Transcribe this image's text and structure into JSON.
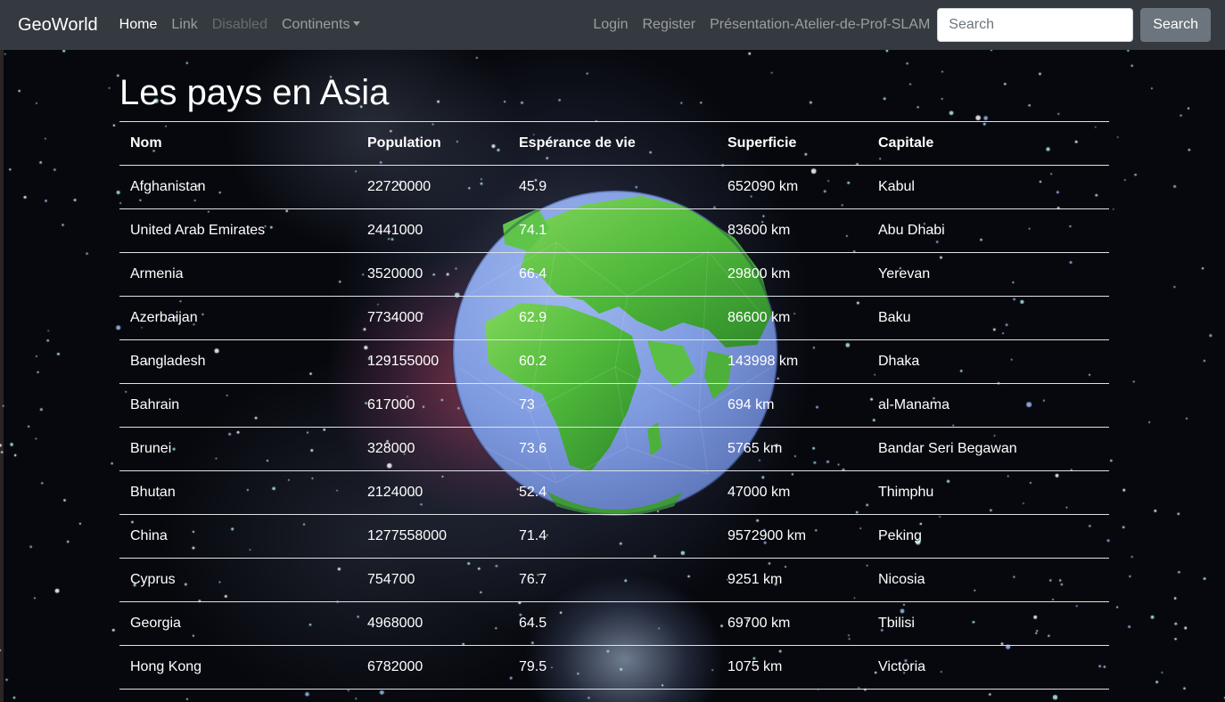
{
  "navbar": {
    "brand": "GeoWorld",
    "links": [
      "Home",
      "Link",
      "Disabled",
      "Continents"
    ],
    "right_links": [
      "Login",
      "Register",
      "Présentation-Atelier-de-Prof-SLAM"
    ],
    "search_placeholder": "Search",
    "search_button": "Search"
  },
  "page": {
    "title": "Les pays en Asia"
  },
  "table": {
    "headers": [
      "Nom",
      "Population",
      "Espérance de vie",
      "Superficie",
      "Capitale"
    ],
    "rows": [
      [
        "Afghanistan",
        "22720000",
        "45.9",
        "652090 km",
        "Kabul"
      ],
      [
        "United Arab Emirates",
        "2441000",
        "74.1",
        "83600 km",
        "Abu Dhabi"
      ],
      [
        "Armenia",
        "3520000",
        "66.4",
        "29800 km",
        "Yerevan"
      ],
      [
        "Azerbaijan",
        "7734000",
        "62.9",
        "86600 km",
        "Baku"
      ],
      [
        "Bangladesh",
        "129155000",
        "60.2",
        "143998 km",
        "Dhaka"
      ],
      [
        "Bahrain",
        "617000",
        "73",
        "694 km",
        "al-Manama"
      ],
      [
        "Brunei",
        "328000",
        "73.6",
        "5765 km",
        "Bandar Seri Begawan"
      ],
      [
        "Bhutan",
        "2124000",
        "52.4",
        "47000 km",
        "Thimphu"
      ],
      [
        "China",
        "1277558000",
        "71.4",
        "9572900 km",
        "Peking"
      ],
      [
        "Cyprus",
        "754700",
        "76.7",
        "9251 km",
        "Nicosia"
      ],
      [
        "Georgia",
        "4968000",
        "64.5",
        "69700 km",
        "Tbilisi"
      ],
      [
        "Hong Kong",
        "6782000",
        "79.5",
        "1075 km",
        "Victoria"
      ]
    ]
  }
}
